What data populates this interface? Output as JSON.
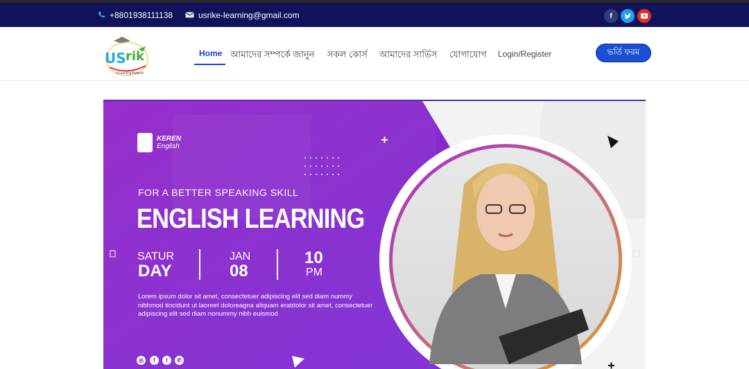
{
  "topbar": {
    "phone": "+8801938111138",
    "email": "usrike-learning@gmail.com",
    "social": [
      {
        "icon": "facebook-icon",
        "glyph": "f",
        "color": "#3b5998"
      },
      {
        "icon": "twitter-icon",
        "glyph": "t",
        "color": "#1da1f2"
      },
      {
        "icon": "youtube-icon",
        "glyph": "▶",
        "color": "#e52d27"
      }
    ]
  },
  "nav": {
    "items": [
      {
        "label": "Home",
        "active": true
      },
      {
        "label": "আমাদের সম্পর্কে জানুন"
      },
      {
        "label": "সকল কোর্স"
      },
      {
        "label": "আমাদের সার্ভিস"
      },
      {
        "label": "যোগাযোগ"
      },
      {
        "label": "Login/Register"
      }
    ],
    "cta": "ভর্তি ফরম"
  },
  "banner": {
    "brand_line1": "KEREN",
    "brand_line2": "English",
    "tagline": "FOR A BETTER SPEAKING SKILL",
    "headline": "ENGLISH LEARNING",
    "day_top": "SATUR",
    "day_bottom": "DAY",
    "month": "JAN",
    "date": "08",
    "time": "10",
    "ampm": "PM",
    "body": "Lorem ipsum dolor sit amet, consectetuer adipiscing elit sed diam nummy nibhmod tincidunt ut laoreet doloreagna aliquam eratdolor sit amet, consectetuer adipiscing elit sed diam nonummy nibh euismod",
    "social": [
      "instagram-icon",
      "facebook-icon",
      "twitter-icon",
      "whatsapp-icon"
    ],
    "social_glyphs": [
      "◎",
      "f",
      "t",
      "✆"
    ]
  },
  "colors": {
    "topbar_bg": "#12125c",
    "accent": "#1a4fd4",
    "banner_purple": "#8b2bd0",
    "ring": "#d8892a"
  }
}
